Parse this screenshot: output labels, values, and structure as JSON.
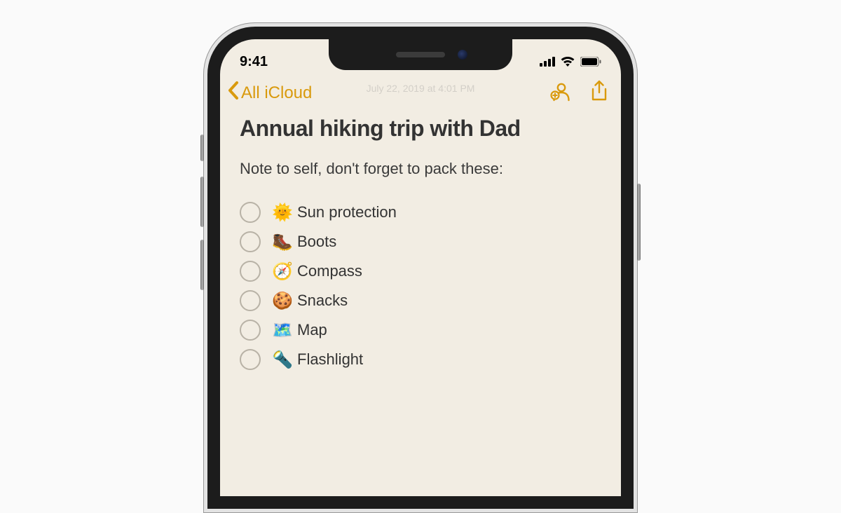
{
  "status": {
    "time": "9:41"
  },
  "nav": {
    "back_label": "All iCloud",
    "faded_date": "July 22, 2019 at 4:01 PM"
  },
  "note": {
    "title": "Annual hiking trip with Dad",
    "subtitle": "Note to self, don't forget to pack these:",
    "items": [
      {
        "emoji": "🌞",
        "label": "Sun protection"
      },
      {
        "emoji": "🥾",
        "label": "Boots"
      },
      {
        "emoji": "🧭",
        "label": "Compass"
      },
      {
        "emoji": "🍪",
        "label": "Snacks"
      },
      {
        "emoji": "🗺️",
        "label": "Map"
      },
      {
        "emoji": "🔦",
        "label": "Flashlight"
      }
    ]
  },
  "colors": {
    "accent": "#d99a0d",
    "paper": "#f2ede3"
  }
}
